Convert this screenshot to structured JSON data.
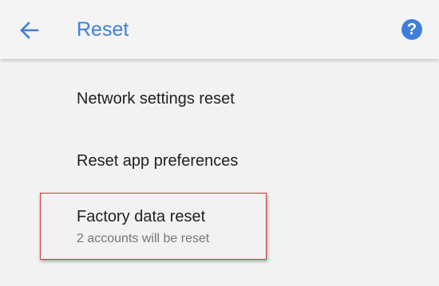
{
  "app_bar": {
    "title": "Reset",
    "back_icon": "arrow-back-icon",
    "help_icon": "help-circle-icon",
    "help_glyph": "?",
    "accent_color": "#3f7fdc"
  },
  "items": [
    {
      "title": "Network settings reset"
    },
    {
      "title": "Reset app preferences"
    },
    {
      "title": "Factory data reset",
      "subtitle": "2 accounts will be reset"
    }
  ],
  "highlight": {
    "target": "Factory data reset",
    "color": "#d9343a"
  }
}
